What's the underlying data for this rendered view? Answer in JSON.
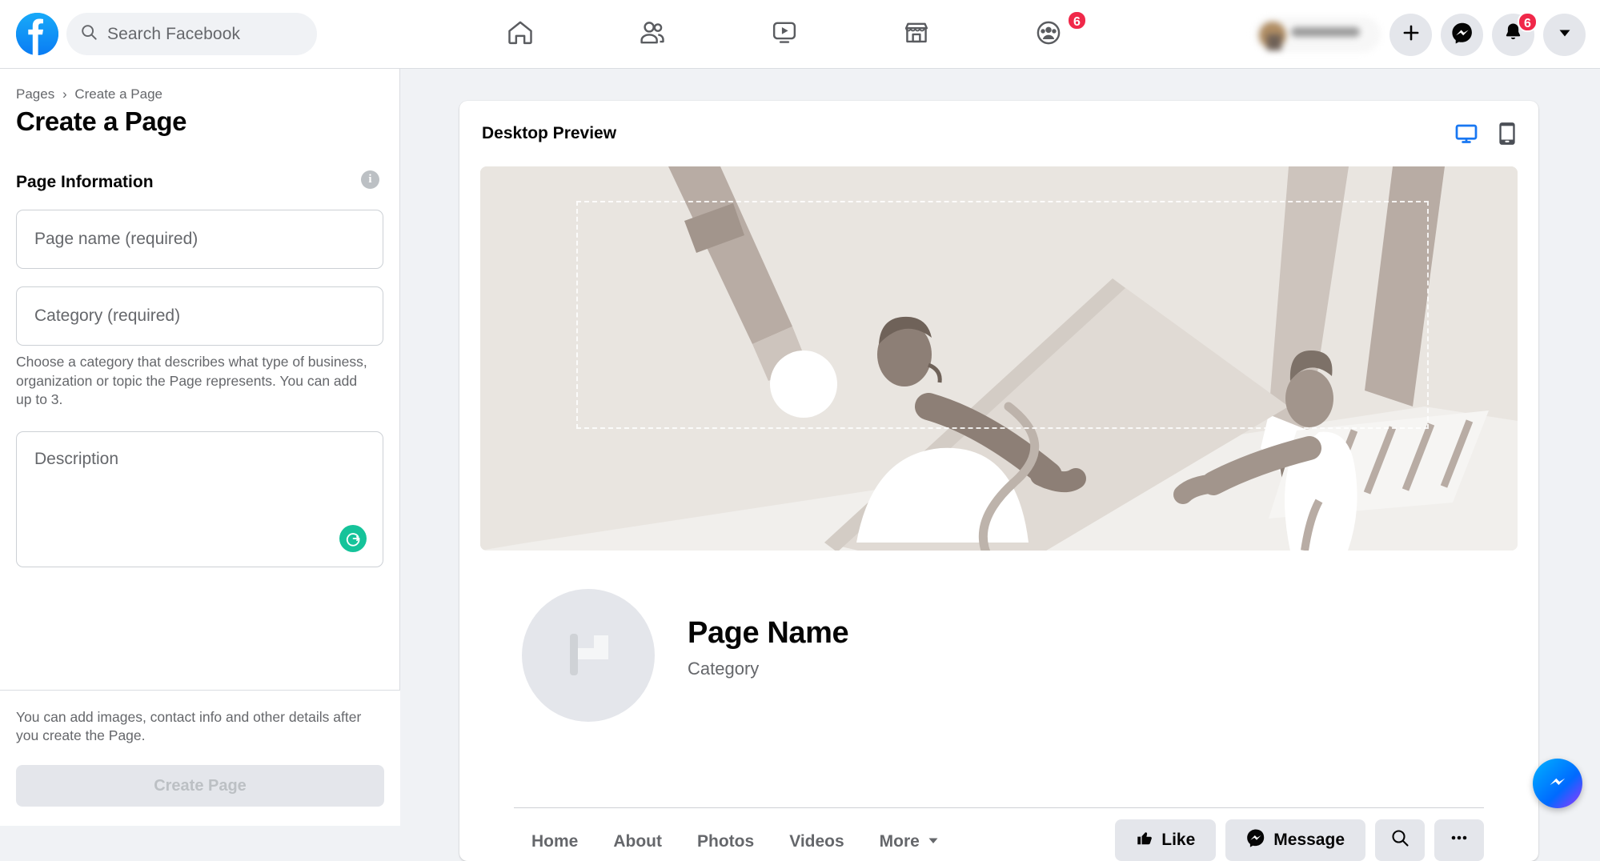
{
  "topbar": {
    "logo": "facebook-logo",
    "search": {
      "placeholder": "Search Facebook",
      "icon": "search-icon"
    },
    "nav": [
      {
        "name": "home",
        "icon": "home-icon"
      },
      {
        "name": "friends",
        "icon": "friends-icon"
      },
      {
        "name": "watch",
        "icon": "watch-video-icon"
      },
      {
        "name": "marketplace",
        "icon": "marketplace-store-icon"
      },
      {
        "name": "groups",
        "icon": "groups-icon",
        "badge": "6"
      }
    ],
    "right": {
      "create_icon": "plus-icon",
      "messenger_icon": "messenger-icon",
      "notifications_icon": "bell-icon",
      "notifications_badge": "6",
      "account_icon": "chevron-down-icon"
    }
  },
  "sidebar": {
    "breadcrumb": {
      "root": "Pages",
      "separator": "›",
      "current": "Create a Page"
    },
    "title": "Create a Page",
    "info_icon": "info-icon",
    "section_title": "Page Information",
    "fields": {
      "page_name_placeholder": "Page name (required)",
      "category_placeholder": "Category (required)",
      "category_helper": "Choose a category that describes what type of business, organization or topic the Page represents. You can add up to 3.",
      "description_placeholder": "Description",
      "grammarly_icon": "grammarly-icon"
    },
    "footer": {
      "note": "You can add images, contact info and other details after you create the Page.",
      "create_button": "Create Page"
    }
  },
  "preview": {
    "title": "Desktop Preview",
    "toggles": [
      {
        "name": "desktop",
        "icon": "monitor-icon",
        "active": true,
        "color": "#1877f2"
      },
      {
        "name": "mobile",
        "icon": "mobile-phone-icon",
        "active": false,
        "color": "#4b4f56"
      }
    ],
    "cover_alt": "illustration-people-building-page",
    "avatar_icon": "flag-placeholder-icon",
    "page_name": "Page Name",
    "page_category": "Category",
    "tabs": [
      {
        "label": "Home"
      },
      {
        "label": "About"
      },
      {
        "label": "Photos"
      },
      {
        "label": "Videos"
      },
      {
        "label": "More",
        "icon": "caret-down-icon"
      }
    ],
    "actions": [
      {
        "label": "Like",
        "icon": "thumbs-up-icon"
      },
      {
        "label": "Message",
        "icon": "messenger-icon"
      },
      {
        "label": "",
        "icon": "search-icon"
      },
      {
        "label": "",
        "icon": "ellipsis-icon"
      }
    ]
  },
  "chat_fab": {
    "icon": "messenger-icon"
  },
  "colors": {
    "brand_blue": "#1877f2",
    "badge_red": "#f02849",
    "grammarly_green": "#15c39a",
    "page_bg": "#f0f2f5"
  }
}
